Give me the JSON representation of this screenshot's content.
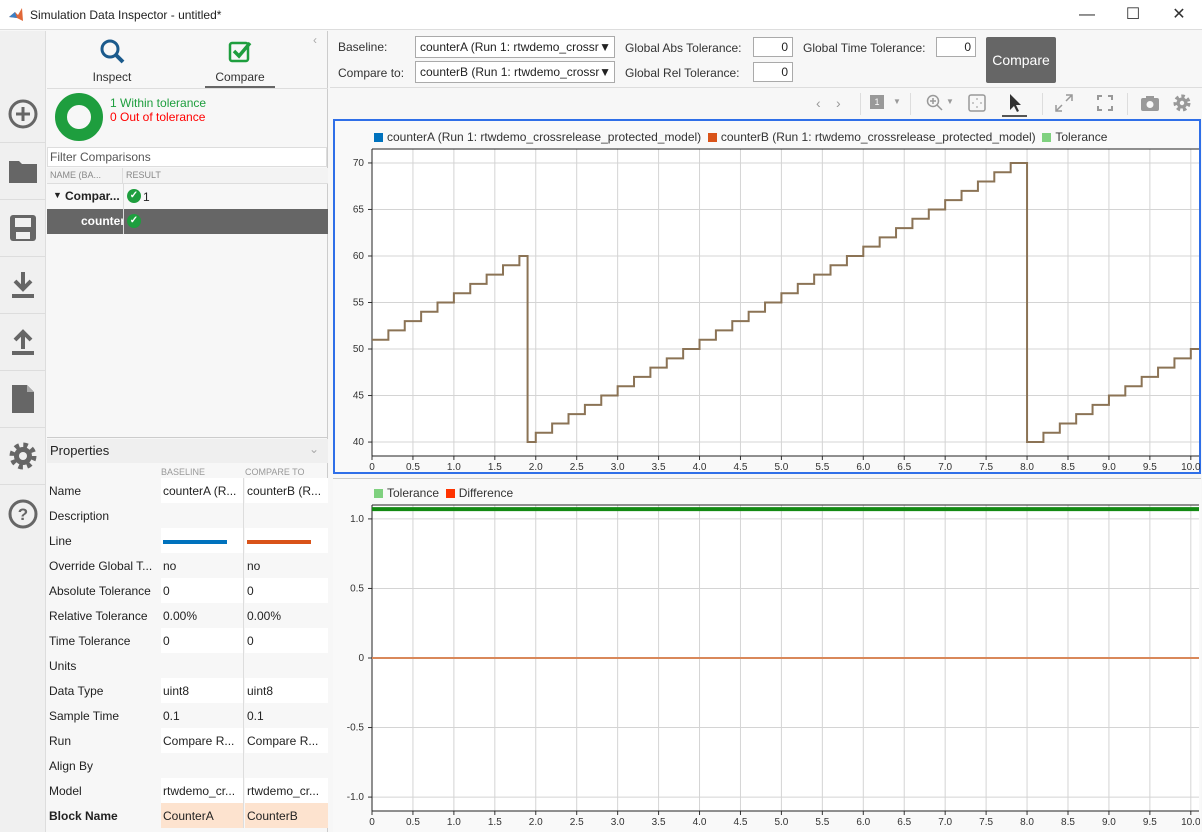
{
  "window": {
    "title": "Simulation Data Inspector - untitled*",
    "minimize": "—",
    "maximize": "☐",
    "close": "✕"
  },
  "rail": {
    "items": [
      "add-icon",
      "folder-icon",
      "save-icon",
      "download-icon",
      "upload-icon",
      "document-icon",
      "gear-icon",
      "help-icon"
    ]
  },
  "tabs": {
    "inspect": "Inspect",
    "compare": "Compare",
    "active": "Compare"
  },
  "summary": {
    "within": "1 Within tolerance",
    "out": "0 Out of tolerance",
    "within_color": "#1e9e3e",
    "out_color": "#ff0000"
  },
  "comparisons": {
    "filter_placeholder": "Filter Comparisons",
    "col_name": "NAME (BA...",
    "col_result": "RESULT",
    "rows": [
      {
        "name": "Compar...",
        "result": "1"
      },
      {
        "name": "counterA",
        "result": ""
      }
    ]
  },
  "properties": {
    "title": "Properties",
    "col_baseline": "BASELINE",
    "col_compare": "COMPARE TO",
    "rows": [
      {
        "label": "Name",
        "baseline": "counterA (R...",
        "compare": "counterB (R..."
      },
      {
        "label": "Description",
        "baseline": "",
        "compare": ""
      },
      {
        "label": "Line",
        "baseline": "",
        "compare": ""
      },
      {
        "label": "Override Global T...",
        "baseline": "no",
        "compare": "no"
      },
      {
        "label": "Absolute Tolerance",
        "baseline": "0",
        "compare": "0"
      },
      {
        "label": "Relative Tolerance",
        "baseline": "0.00%",
        "compare": "0.00%"
      },
      {
        "label": "Time Tolerance",
        "baseline": "0",
        "compare": "0"
      },
      {
        "label": "Units",
        "baseline": "",
        "compare": ""
      },
      {
        "label": "Data Type",
        "baseline": "uint8",
        "compare": "uint8"
      },
      {
        "label": "Sample Time",
        "baseline": "0.1",
        "compare": "0.1"
      },
      {
        "label": "Run",
        "baseline": "Compare R...",
        "compare": "Compare R..."
      },
      {
        "label": "Align By",
        "baseline": "",
        "compare": ""
      },
      {
        "label": "Model",
        "baseline": "rtwdemo_cr...",
        "compare": "rtwdemo_cr..."
      },
      {
        "label": "Block Name",
        "baseline": "CounterA",
        "compare": "CounterB"
      }
    ],
    "line_colors": {
      "baseline": "#0072bd",
      "compare": "#d95319"
    }
  },
  "compare_bar": {
    "baseline_label": "Baseline:",
    "baseline_value": "counterA (Run 1: rtwdemo_crossr",
    "compare_label": "Compare to:",
    "compare_value": "counterB (Run 1: rtwdemo_crossr",
    "abs_label": "Global Abs Tolerance:",
    "abs_value": "0",
    "rel_label": "Global Rel Tolerance:",
    "rel_value": "0",
    "time_label": "Global Time Tolerance:",
    "time_value": "0",
    "compare_button": "Compare"
  },
  "toolbar": {
    "layout_value": "1"
  },
  "chart_data": [
    {
      "type": "line",
      "legend": [
        "counterA (Run 1: rtwdemo_crossrelease_protected_model)",
        "counterB (Run 1: rtwdemo_crossrelease_protected_model)",
        "Tolerance"
      ],
      "legend_colors": [
        "#0072bd",
        "#d95319",
        "#7fd17f"
      ],
      "line_color": "#8b7355",
      "step": true,
      "xlim": [
        0,
        10.1
      ],
      "ylim": [
        38.5,
        71.5
      ],
      "grid": true,
      "legend_position": "top",
      "xticks": [
        "0",
        "0.5",
        "1.0",
        "1.5",
        "2.0",
        "2.5",
        "3.0",
        "3.5",
        "4.0",
        "4.5",
        "5.0",
        "5.5",
        "6.0",
        "6.5",
        "7.0",
        "7.5",
        "8.0",
        "8.5",
        "9.0",
        "9.5",
        "10.0"
      ],
      "yticks": [
        "40",
        "45",
        "50",
        "55",
        "60",
        "65",
        "70"
      ],
      "series": [
        {
          "x": [
            0,
            0.2,
            0.4,
            0.6,
            0.8,
            1.0,
            1.2,
            1.4,
            1.6,
            1.8,
            1.9,
            2.0,
            2.2,
            2.4,
            2.6,
            2.8,
            3.0,
            3.2,
            3.4,
            3.6,
            3.8,
            4.0,
            4.2,
            4.4,
            4.6,
            4.8,
            5.0,
            5.2,
            5.4,
            5.6,
            5.8,
            6.0,
            6.2,
            6.4,
            6.6,
            6.8,
            7.0,
            7.2,
            7.4,
            7.6,
            7.8,
            8.0,
            8.2,
            8.4,
            8.6,
            8.8,
            9.0,
            9.2,
            9.4,
            9.6,
            9.8,
            10.0
          ],
          "y": [
            51,
            52,
            53,
            54,
            55,
            56,
            57,
            58,
            59,
            60,
            40,
            41,
            42,
            43,
            44,
            45,
            46,
            47,
            48,
            49,
            50,
            51,
            52,
            53,
            54,
            55,
            56,
            57,
            58,
            59,
            60,
            61,
            62,
            63,
            64,
            65,
            66,
            67,
            68,
            69,
            70,
            40,
            41,
            42,
            43,
            44,
            45,
            46,
            47,
            48,
            49,
            50
          ]
        }
      ]
    },
    {
      "type": "line",
      "legend": [
        "Tolerance",
        "Difference"
      ],
      "legend_colors": [
        "#7fd17f",
        "#ff3300"
      ],
      "xlim": [
        0,
        10.1
      ],
      "ylim": [
        -1.1,
        1.1
      ],
      "grid": true,
      "legend_position": "top",
      "xticks": [
        "0",
        "0.5",
        "1.0",
        "1.5",
        "2.0",
        "2.5",
        "3.0",
        "3.5",
        "4.0",
        "4.5",
        "5.0",
        "5.5",
        "6.0",
        "6.5",
        "7.0",
        "7.5",
        "8.0",
        "8.5",
        "9.0",
        "9.5",
        "10.0"
      ],
      "yticks": [
        "-1.0",
        "-0.5",
        "0",
        "0.5",
        "1.0"
      ],
      "series": [
        {
          "name": "Tolerance",
          "x": [
            0,
            10.1
          ],
          "y": [
            1.07,
            1.07
          ],
          "color": "#138a13"
        },
        {
          "name": "Difference",
          "x": [
            0,
            10.1
          ],
          "y": [
            0,
            0
          ],
          "color": "#d9885a"
        }
      ]
    }
  ]
}
